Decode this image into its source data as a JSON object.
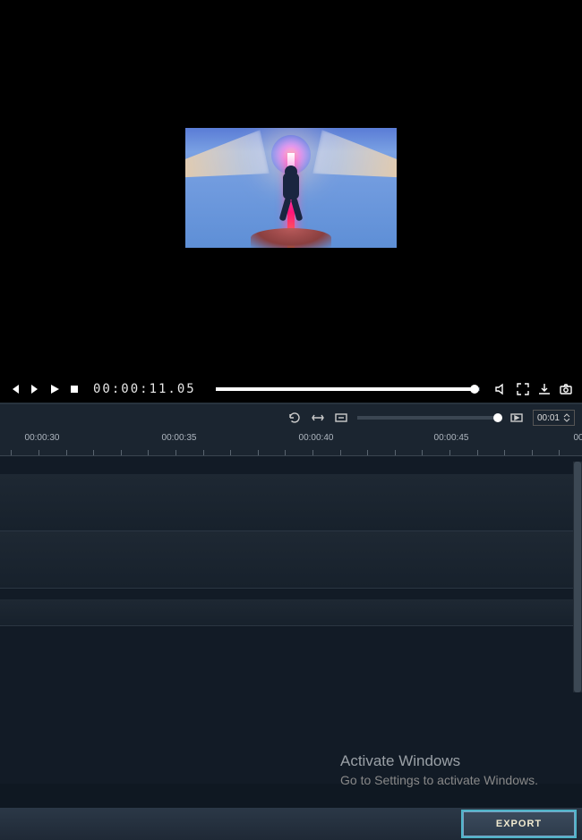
{
  "playback": {
    "timecode": "00:00:11.05",
    "progress_pct": 98
  },
  "zoom": {
    "value": "00:01",
    "pct": 98
  },
  "ruler": {
    "labels": [
      {
        "text": "00:00:30",
        "pos": 47
      },
      {
        "text": "00:00:35",
        "pos": 200
      },
      {
        "text": "00:00:40",
        "pos": 353
      },
      {
        "text": "00:00:45",
        "pos": 504
      },
      {
        "text": "00",
        "pos": 646
      }
    ]
  },
  "watermark": {
    "title": "Activate Windows",
    "subtitle": "Go to Settings to activate Windows."
  },
  "export_label": "EXPORT",
  "tracks": {
    "rows": [
      {
        "h": 64
      },
      {
        "h": 64
      }
    ]
  }
}
